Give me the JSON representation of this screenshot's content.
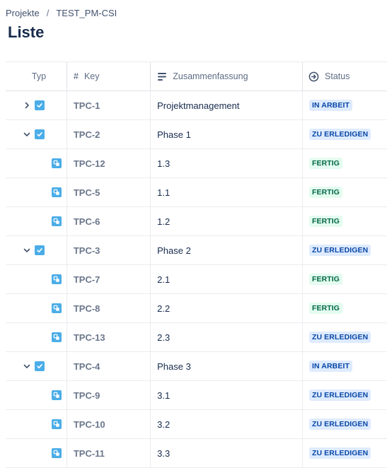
{
  "breadcrumb": {
    "project": "Projekte",
    "separator": "/",
    "current": "TEST_PM-CSI"
  },
  "page_title": "Liste",
  "columns": {
    "typ": "Typ",
    "key": "Key",
    "summary": "Zusammenfassung",
    "status": "Status"
  },
  "status_colors": {
    "IN ARBEIT": "blue",
    "ZU ERLEDIGEN": "blue",
    "FERTIG": "green"
  },
  "rows": [
    {
      "level": 0,
      "expand": "collapsed",
      "type": "task",
      "key": "TPC-1",
      "summary": "Projektmanagement",
      "status": "IN ARBEIT"
    },
    {
      "level": 0,
      "expand": "expanded",
      "type": "task",
      "key": "TPC-2",
      "summary": "Phase 1",
      "status": "ZU ERLEDIGEN"
    },
    {
      "level": 1,
      "expand": "none",
      "type": "subtask",
      "key": "TPC-12",
      "summary": "1.3",
      "status": "FERTIG"
    },
    {
      "level": 1,
      "expand": "none",
      "type": "subtask",
      "key": "TPC-5",
      "summary": "1.1",
      "status": "FERTIG"
    },
    {
      "level": 1,
      "expand": "none",
      "type": "subtask",
      "key": "TPC-6",
      "summary": "1.2",
      "status": "FERTIG"
    },
    {
      "level": 0,
      "expand": "expanded",
      "type": "task",
      "key": "TPC-3",
      "summary": "Phase 2",
      "status": "ZU ERLEDIGEN"
    },
    {
      "level": 1,
      "expand": "none",
      "type": "subtask",
      "key": "TPC-7",
      "summary": "2.1",
      "status": "FERTIG"
    },
    {
      "level": 1,
      "expand": "none",
      "type": "subtask",
      "key": "TPC-8",
      "summary": "2.2",
      "status": "FERTIG"
    },
    {
      "level": 1,
      "expand": "none",
      "type": "subtask",
      "key": "TPC-13",
      "summary": "2.3",
      "status": "ZU ERLEDIGEN"
    },
    {
      "level": 0,
      "expand": "expanded",
      "type": "task",
      "key": "TPC-4",
      "summary": "Phase 3",
      "status": "IN ARBEIT"
    },
    {
      "level": 1,
      "expand": "none",
      "type": "subtask",
      "key": "TPC-9",
      "summary": "3.1",
      "status": "ZU ERLEDIGEN"
    },
    {
      "level": 1,
      "expand": "none",
      "type": "subtask",
      "key": "TPC-10",
      "summary": "3.2",
      "status": "ZU ERLEDIGEN"
    },
    {
      "level": 1,
      "expand": "none",
      "type": "subtask",
      "key": "TPC-11",
      "summary": "3.3",
      "status": "ZU ERLEDIGEN"
    }
  ]
}
